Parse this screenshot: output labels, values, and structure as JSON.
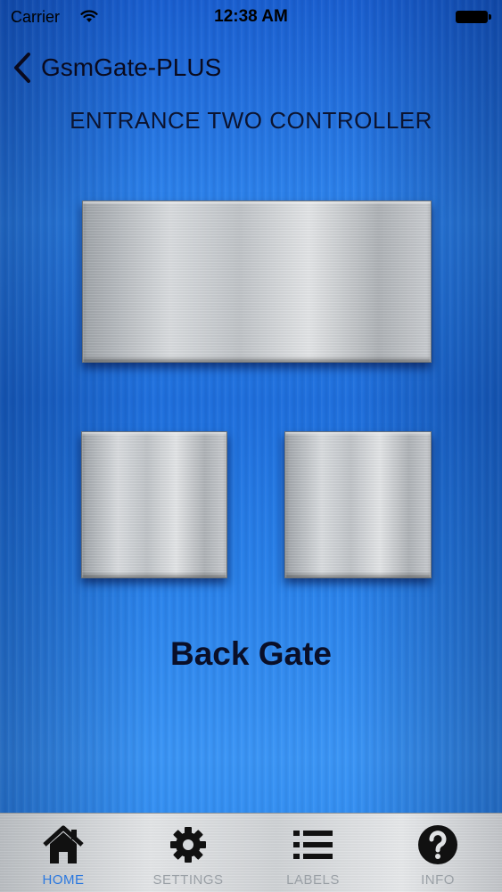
{
  "status_bar": {
    "carrier": "Carrier",
    "time": "12:38 AM"
  },
  "nav": {
    "back_label": "GsmGate-PLUS"
  },
  "page": {
    "title": "ENTRANCE TWO CONTROLLER",
    "gate_label": "Back Gate"
  },
  "tabs": [
    {
      "label": "HOME",
      "icon": "home-icon",
      "active": true
    },
    {
      "label": "SETTINGS",
      "icon": "gear-icon",
      "active": false
    },
    {
      "label": "LABELS",
      "icon": "list-icon",
      "active": false
    },
    {
      "label": "INFO",
      "icon": "question-icon",
      "active": false
    }
  ],
  "colors": {
    "background": "#2a82ea",
    "active_tab": "#2a78e0",
    "inactive_tab": "#9aa0a6"
  }
}
